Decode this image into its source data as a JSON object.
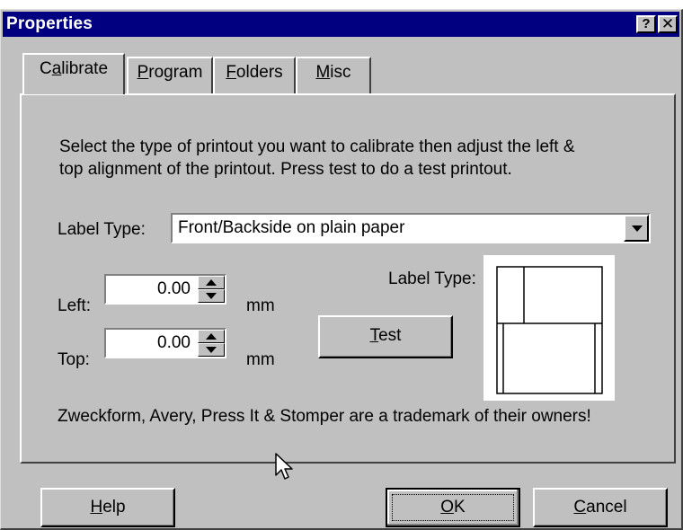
{
  "window": {
    "title": "Properties",
    "help_glyph": "?",
    "close_glyph": "✕"
  },
  "tabs": [
    {
      "pre": "C",
      "u": "a",
      "post": "librate",
      "selected": true
    },
    {
      "pre": "",
      "u": "P",
      "post": "rogram",
      "selected": false
    },
    {
      "pre": "",
      "u": "F",
      "post": "olders",
      "selected": false
    },
    {
      "pre": "",
      "u": "M",
      "post": "isc",
      "selected": false
    }
  ],
  "calibrate": {
    "instructions_line1": "Select the type of printout you want to calibrate then adjust the left &",
    "instructions_line2": "top alignment of the printout. Press test to do a test printout.",
    "label_type_label": "Label Type:",
    "label_type_value": "Front/Backside on plain paper",
    "left_label": "Left:",
    "left_value": "0.00",
    "top_label": "Top:",
    "top_value": "0.00",
    "unit": "mm",
    "test_button": {
      "u": "T",
      "post": "est"
    },
    "preview_label": "Label Type:",
    "trademark": "Zweckform, Avery, Press It & Stomper are a trademark of their owners!"
  },
  "buttons": {
    "help": {
      "u": "H",
      "post": "elp"
    },
    "ok": {
      "u": "O",
      "post": "K"
    },
    "cancel": {
      "u": "C",
      "post": "ancel"
    }
  }
}
